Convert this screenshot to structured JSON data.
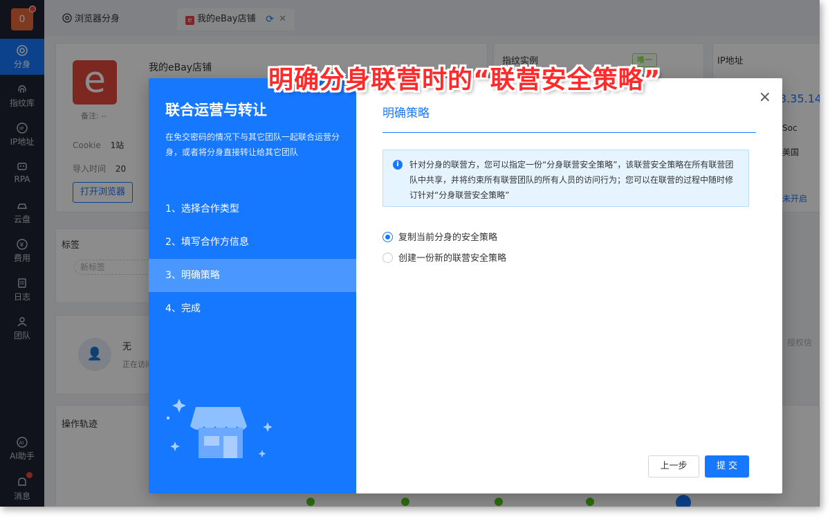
{
  "notification_count": "0",
  "sidebar": {
    "items": [
      {
        "label": "分身",
        "icon": "chrome-icon"
      },
      {
        "label": "指纹库",
        "icon": "fingerprint-icon"
      },
      {
        "label": "IP地址",
        "icon": "ip-icon"
      },
      {
        "label": "RPA",
        "icon": "robot-icon"
      },
      {
        "label": "云盘",
        "icon": "cloud-drive-icon"
      },
      {
        "label": "费用",
        "icon": "yen-icon"
      },
      {
        "label": "日志",
        "icon": "log-icon"
      },
      {
        "label": "团队",
        "icon": "team-icon"
      }
    ],
    "bottom": [
      {
        "label": "AI助手",
        "icon": "ai-icon"
      },
      {
        "label": "消息",
        "icon": "bell-icon"
      }
    ]
  },
  "tabs": [
    {
      "label": "浏览器分身"
    },
    {
      "label": "我的eBay店铺"
    }
  ],
  "profile": {
    "name": "我的eBay店铺",
    "remark": "备注: --",
    "cookie_label": "Cookie",
    "cookie_value": "1站",
    "import_label": "导入时间",
    "import_value": "20",
    "open_button": "打开浏览器"
  },
  "fingerprint": {
    "title": "指纹实例",
    "badge": "唯一"
  },
  "ip": {
    "title": "IP地址",
    "value": "3.35.14",
    "type": "Soc",
    "country": "美国",
    "status": "未开启"
  },
  "tags": {
    "title": "标签",
    "new_tag": "新标签"
  },
  "user": {
    "name": "无",
    "sub": "正在访问",
    "auth": "授权信"
  },
  "ops": {
    "title": "操作轨迹"
  },
  "modal": {
    "title": "联合运营与转让",
    "description": "在免交密码的情况下与其它团队一起联合运营分身，或者将分身直接转让给其它团队",
    "steps": [
      "1、选择合作类型",
      "2、填写合作方信息",
      "3、明确策略",
      "4、完成"
    ],
    "active_step": 2,
    "section_title": "明确策略",
    "info": "针对分身的联营方，您可以指定一份“分身联营安全策略”，该联营安全策略在所有联营团队中共享，并将约束所有联营团队的所有人员的访问行为；您可以在联营的过程中随时修订针对“分身联营安全策略”",
    "options": [
      {
        "label": "复制当前分身的安全策略",
        "checked": true
      },
      {
        "label": "创建一份新的联营安全策略",
        "checked": false
      }
    ],
    "prev_button": "上一步",
    "submit_button": "提 交",
    "close": "×"
  },
  "annotation": "明确分身联营时的“联营安全策略”",
  "colors": {
    "primary": "#1677ff",
    "sidebar": "#1f2433",
    "annotation": "#ff2a2a"
  }
}
